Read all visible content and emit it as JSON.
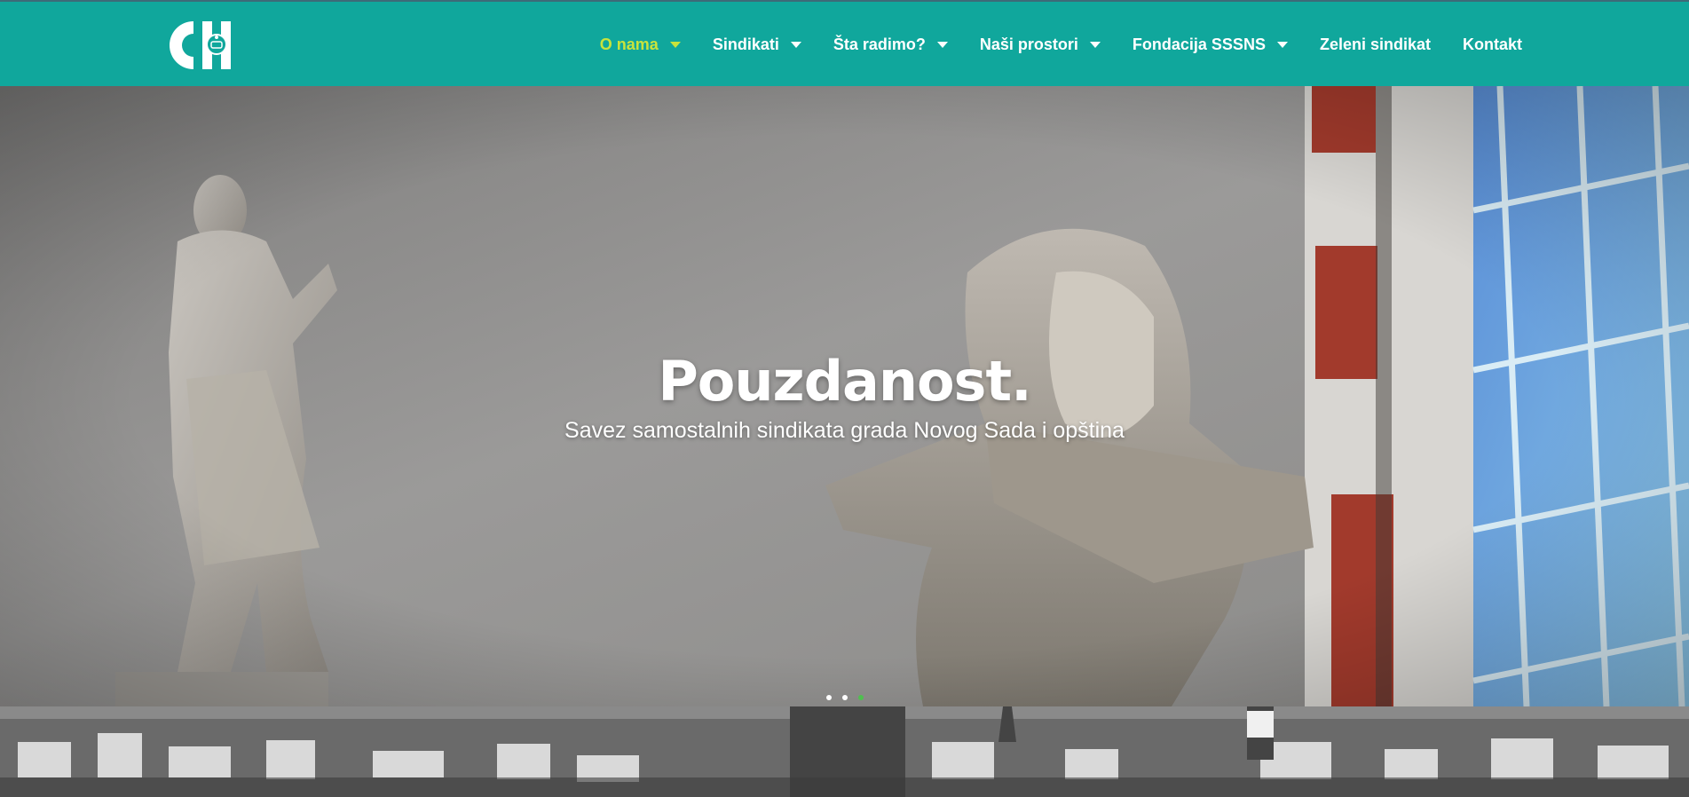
{
  "header": {
    "logo_alt": "SSSNS logo",
    "nav": [
      {
        "label": "O nama",
        "dropdown": true,
        "active": true
      },
      {
        "label": "Sindikati",
        "dropdown": true
      },
      {
        "label": "Šta radimo?",
        "dropdown": true
      },
      {
        "label": "Naši prostori",
        "dropdown": true
      },
      {
        "label": "Fondacija SSSNS",
        "dropdown": true
      },
      {
        "label": "Zeleni sindikat",
        "dropdown": false
      },
      {
        "label": "Kontakt",
        "dropdown": false
      }
    ]
  },
  "hero": {
    "title": "Pouzdanost.",
    "subtitle": "Savez samostalnih sindikata grada Novog Sada i opština",
    "slides_total": 3,
    "active_slide": 3
  },
  "colors": {
    "header_bg": "#10a79c",
    "nav_text": "#ffffff",
    "nav_active": "#c8e33c",
    "dot_active": "#4fbf4f"
  },
  "icons": {
    "caret": "caret-down-icon",
    "logo": "sssns-logo-icon"
  }
}
